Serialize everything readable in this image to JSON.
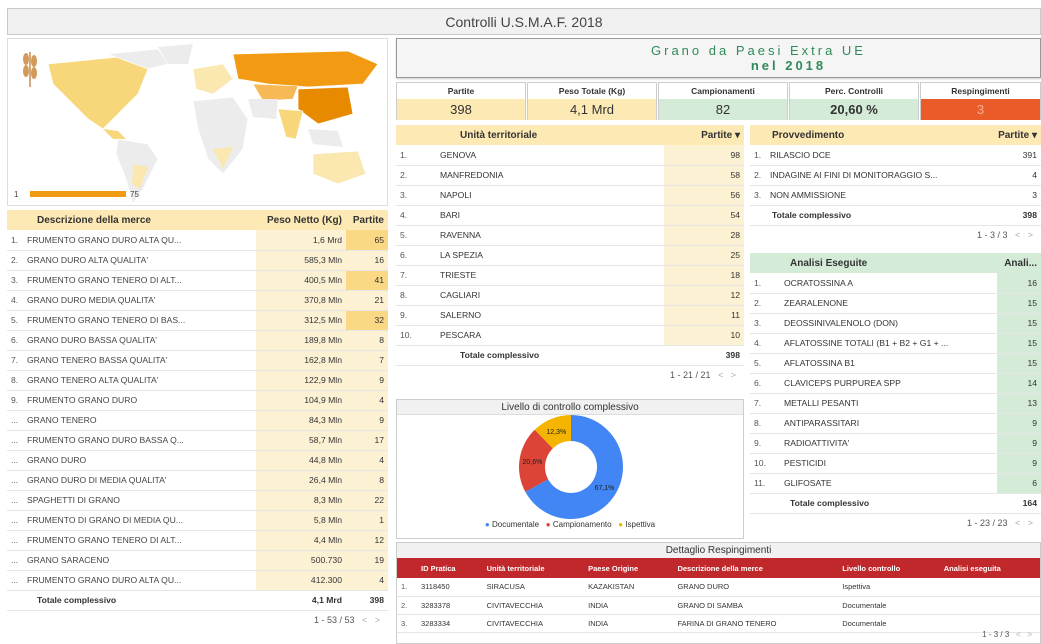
{
  "title": "Controlli U.S.M.A.F. 2018",
  "headline": {
    "line1": "Grano da Paesi Extra UE",
    "line2": "nel 2018"
  },
  "map": {
    "legend_max": "75",
    "legend_min": "1"
  },
  "kpis": [
    {
      "label": "Partite",
      "value": "398",
      "bg": "#fde9b4"
    },
    {
      "label": "Peso Totale (Kg)",
      "value": "4,1 Mrd",
      "bg": "#fde9b4"
    },
    {
      "label": "Campionamenti",
      "value": "82",
      "bg": "#d4ebd7"
    },
    {
      "label": "Perc. Controlli",
      "value": "20,60 %",
      "bg": "#d4ebd7"
    },
    {
      "label": "Respingimenti",
      "value": "3",
      "bg": "#ea5b2a"
    }
  ],
  "merce": {
    "headers": [
      "Descrizione della merce",
      "Peso Netto (Kg)",
      "Partite"
    ],
    "rows": [
      [
        "1.",
        "FRUMENTO GRANO DURO ALTA QU...",
        "1,6 Mrd",
        "65"
      ],
      [
        "2.",
        "GRANO DURO ALTA QUALITA'",
        "585,3 Mln",
        "16"
      ],
      [
        "3.",
        "FRUMENTO GRANO TENERO DI ALT...",
        "400,5 Mln",
        "41"
      ],
      [
        "4.",
        "GRANO DURO MEDIA QUALITA'",
        "370,8 Mln",
        "21"
      ],
      [
        "5.",
        "FRUMENTO GRANO TENERO DI BAS...",
        "312,5 Mln",
        "32"
      ],
      [
        "6.",
        "GRANO DURO BASSA QUALITA'",
        "189,8 Mln",
        "8"
      ],
      [
        "7.",
        "GRANO TENERO BASSA QUALITA'",
        "162,8 Mln",
        "7"
      ],
      [
        "8.",
        "GRANO TENERO ALTA QUALITA'",
        "122,9 Mln",
        "9"
      ],
      [
        "9.",
        "FRUMENTO GRANO DURO",
        "104,9 Mln",
        "4"
      ],
      [
        "...",
        "GRANO TENERO",
        "84,3 Mln",
        "9"
      ],
      [
        "...",
        "FRUMENTO GRANO DURO BASSA Q...",
        "58,7 Mln",
        "17"
      ],
      [
        "...",
        "GRANO DURO",
        "44,8 Mln",
        "4"
      ],
      [
        "...",
        "GRANO DURO DI MEDIA QUALITA'",
        "26,4 Mln",
        "8"
      ],
      [
        "...",
        "SPAGHETTI DI GRANO",
        "8,3 Mln",
        "22"
      ],
      [
        "...",
        "FRUMENTO DI GRANO DI MEDIA QU...",
        "5,8 Mln",
        "1"
      ],
      [
        "...",
        "FRUMENTO GRANO TENERO DI ALT...",
        "4,4 Mln",
        "12"
      ],
      [
        "...",
        "GRANO SARACENO",
        "500.730",
        "19"
      ],
      [
        "...",
        "FRUMENTO GRANO DURO ALTA QU...",
        "412.300",
        "4"
      ]
    ],
    "total": [
      "Totale complessivo",
      "4,1 Mrd",
      "398"
    ],
    "pagination": "1 - 53 / 53"
  },
  "unita": {
    "headers": [
      "Unità territoriale",
      "Partite ▾"
    ],
    "rows": [
      [
        "1.",
        "GENOVA",
        "98"
      ],
      [
        "2.",
        "MANFREDONIA",
        "58"
      ],
      [
        "3.",
        "NAPOLI",
        "56"
      ],
      [
        "4.",
        "BARI",
        "54"
      ],
      [
        "5.",
        "RAVENNA",
        "28"
      ],
      [
        "6.",
        "LA SPEZIA",
        "25"
      ],
      [
        "7.",
        "TRIESTE",
        "18"
      ],
      [
        "8.",
        "CAGLIARI",
        "12"
      ],
      [
        "9.",
        "SALERNO",
        "11"
      ],
      [
        "10.",
        "PESCARA",
        "10"
      ]
    ],
    "total": [
      "Totale complessivo",
      "398"
    ],
    "pagination": "1 - 21 / 21"
  },
  "provv": {
    "headers": [
      "Provvedimento",
      "Partite ▾"
    ],
    "rows": [
      [
        "1.",
        "RILASCIO DCE",
        "391"
      ],
      [
        "2.",
        "INDAGINE AI FINI DI MONITORAGGIO S...",
        "4"
      ],
      [
        "3.",
        "NON AMMISSIONE",
        "3"
      ]
    ],
    "total": [
      "Totale complessivo",
      "398"
    ],
    "pagination": "1 - 3 / 3"
  },
  "analisi": {
    "headers": [
      "Analisi Eseguite",
      "Anali..."
    ],
    "rows": [
      [
        "1.",
        "OCRATOSSINA A",
        "16"
      ],
      [
        "2.",
        "ZEARALENONE",
        "15"
      ],
      [
        "3.",
        "DEOSSINIVALENOLO (DON)",
        "15"
      ],
      [
        "4.",
        "AFLATOSSINE TOTALI (B1 + B2 + G1 + ...",
        "15"
      ],
      [
        "5.",
        "AFLATOSSINA B1",
        "15"
      ],
      [
        "6.",
        "CLAVICEPS PURPUREA SPP",
        "14"
      ],
      [
        "7.",
        "METALLI PESANTI",
        "13"
      ],
      [
        "8.",
        "ANTIPARASSITARI",
        "9"
      ],
      [
        "9.",
        "RADIOATTIVITA'",
        "9"
      ],
      [
        "10.",
        "PESTICIDI",
        "9"
      ],
      [
        "11.",
        "GLIFOSATE",
        "6"
      ]
    ],
    "total": [
      "Totale complessivo",
      "164"
    ],
    "pagination": "1 - 23 / 23"
  },
  "donut": {
    "title": "Livello di controllo complessivo",
    "labels": [
      "67,1%",
      "20,6%",
      "12,3%"
    ],
    "legend": [
      "Documentale",
      "Campionamento",
      "Ispettiva"
    ]
  },
  "dettaglio": {
    "title": "Dettaglio Respingimenti",
    "headers": [
      "ID Pratica",
      "Unità territoriale",
      "Paese Origine",
      "Descrizione della merce",
      "Livello controllo",
      "Analisi eseguita"
    ],
    "rows": [
      [
        "1.",
        "3118450",
        "SIRACUSA",
        "KAZAKISTAN",
        "GRANO DURO",
        "Ispettiva",
        ""
      ],
      [
        "2.",
        "3283378",
        "CIVITAVECCHIA",
        "INDIA",
        "GRANO DI SAMBA",
        "Documentale",
        ""
      ],
      [
        "3.",
        "3283334",
        "CIVITAVECCHIA",
        "INDIA",
        "FARINA DI GRANO TENERO",
        "Documentale",
        ""
      ]
    ],
    "pagination": "1 - 3 / 3"
  },
  "chart_data": [
    {
      "type": "pie",
      "title": "Livello di controllo complessivo",
      "categories": [
        "Documentale",
        "Campionamento",
        "Ispettiva"
      ],
      "values": [
        67.1,
        20.6,
        12.3
      ],
      "colors": [
        "#4285f4",
        "#db4437",
        "#f4b400"
      ]
    }
  ],
  "colors": {
    "accent_orange": "#f29b12",
    "highlight_yellow": "#fde9b4",
    "highlight_green": "#d4ebd7",
    "red_header": "#c0282b",
    "headline_green": "#2e8b57"
  }
}
